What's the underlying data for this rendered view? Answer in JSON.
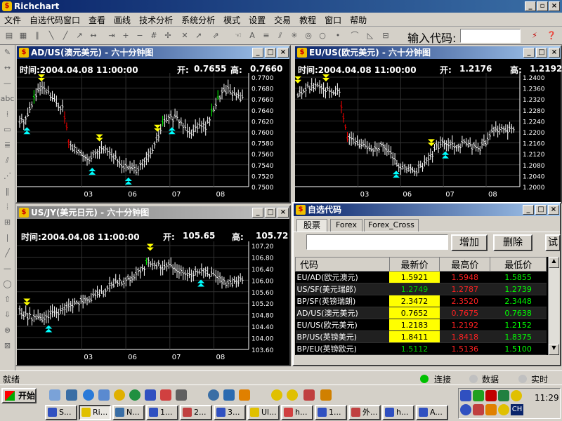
{
  "app": {
    "title": "Richchart"
  },
  "menu": [
    "文件",
    "自选代码窗口",
    "查看",
    "画线",
    "技术分析",
    "系统分析",
    "模式",
    "设置",
    "交易",
    "教程",
    "窗口",
    "帮助"
  ],
  "toolbar": {
    "code_label": "输入代码:"
  },
  "charts": [
    {
      "title": "AD/US(澳元美元) - 六十分钟图",
      "time": "时间:2004.04.08 11:00:00",
      "open_label": "开:",
      "open": "0.7655",
      "high_label": "高:",
      "high": "0.7660",
      "yticks": [
        "0.7700",
        "0.7680",
        "0.7660",
        "0.7640",
        "0.7620",
        "0.7600",
        "0.7580",
        "0.7560",
        "0.7540",
        "0.7520",
        "0.7500"
      ],
      "xticks": [
        "03",
        "06",
        "07",
        "08"
      ]
    },
    {
      "title": "EU/US(欧元美元) - 六十分钟图",
      "time": "时间:2004.04.08 11:00:00",
      "open_label": "开:",
      "open": "1.2176",
      "high_label": "高:",
      "high": "1.2192",
      "yticks": [
        "1.2400",
        "1.2360",
        "1.2320",
        "1.2280",
        "1.2240",
        "1.2200",
        "1.2160",
        "1.2120",
        "1.2080",
        "1.2040",
        "1.2000"
      ],
      "xticks": [
        "03",
        "06",
        "07",
        "08"
      ]
    },
    {
      "title": "US/JY(美元日元) - 六十分钟图",
      "time": "时间:2004.04.08 11:00:00",
      "open_label": "开:",
      "open": "105.65",
      "high_label": "高:",
      "high": "105.72",
      "yticks": [
        "107.20",
        "106.80",
        "106.40",
        "106.00",
        "105.60",
        "105.20",
        "104.80",
        "104.40",
        "104.00",
        "103.60"
      ],
      "xticks": [
        "03",
        "06",
        "07",
        "08"
      ]
    }
  ],
  "quote": {
    "title": "自选代码",
    "tabs": [
      "股票",
      "Forex",
      "Forex_Cross"
    ],
    "add_label": "增加",
    "delete_label": "删除",
    "extra_label": "试",
    "columns": [
      "代码",
      "最新价",
      "最高价",
      "最低价"
    ],
    "rows": [
      {
        "code": "EU/AD(欧元澳元)",
        "last": "1.5921",
        "high": "1.5948",
        "low": "1.5855"
      },
      {
        "code": "US/SF(美元瑞郎)",
        "last": "1.2749",
        "high": "1.2787",
        "low": "1.2739"
      },
      {
        "code": "BP/SF(英镑瑞朗)",
        "last": "2.3472",
        "high": "2.3520",
        "low": "2.3448"
      },
      {
        "code": "AD/US(澳元美元)",
        "last": "0.7652",
        "high": "0.7675",
        "low": "0.7638"
      },
      {
        "code": "EU/US(欧元美元)",
        "last": "1.2183",
        "high": "1.2192",
        "low": "1.2152"
      },
      {
        "code": "BP/US(英镑美元)",
        "last": "1.8411",
        "high": "1.8418",
        "low": "1.8375"
      },
      {
        "code": "BP/EU(英镑欧元)",
        "last": "1.5112",
        "high": "1.5136",
        "low": "1.5100"
      }
    ]
  },
  "status": {
    "ready": "就绪",
    "connect": "连接",
    "data": "数据",
    "realtime": "实时"
  },
  "taskbar": {
    "start": "开始",
    "tasks": [
      "S...",
      "Ri...",
      "N...",
      "1...",
      "2...",
      "3...",
      "Ul...",
      "h...",
      "1...",
      "外...",
      "h...",
      "A..."
    ],
    "clock": "11:29",
    "lang": "CH"
  },
  "colors": {
    "up": "#00ff00",
    "down": "#ff0000",
    "bar": "#ffffff",
    "highlight": "#ffff00",
    "arrow_down": "#ffff00",
    "arrow_up": "#00ffff"
  }
}
